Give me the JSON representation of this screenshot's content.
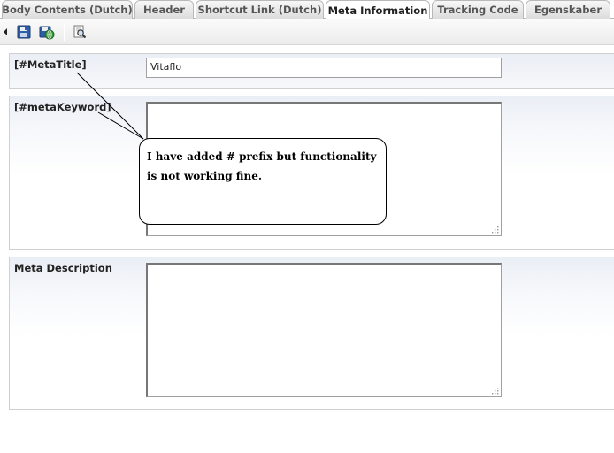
{
  "tabs": [
    {
      "label": "Body Contents (Dutch)",
      "active": false
    },
    {
      "label": "Header",
      "active": false
    },
    {
      "label": "Shortcut Link (Dutch)",
      "active": false
    },
    {
      "label": "Meta Information",
      "active": true
    },
    {
      "label": "Tracking Code",
      "active": false
    },
    {
      "label": "Egenskaber",
      "active": false
    }
  ],
  "toolbar": {
    "icons": [
      "collapse-arrow-icon",
      "save-icon",
      "save-and-publish-icon",
      "preview-icon"
    ]
  },
  "fields": {
    "meta_title": {
      "label": "[#MetaTitle]",
      "value": "Vitaflo"
    },
    "meta_keyword": {
      "label": "[#metaKeyword]",
      "value": ""
    },
    "meta_description": {
      "label": "Meta Description",
      "value": ""
    }
  },
  "annotation": {
    "text": "I have added # prefix but functionality is not working fine."
  },
  "colors": {
    "tab_border": "#b9b9b9",
    "section_gradient_top": "#eaeef5",
    "field_border": "#a0a0a0"
  }
}
